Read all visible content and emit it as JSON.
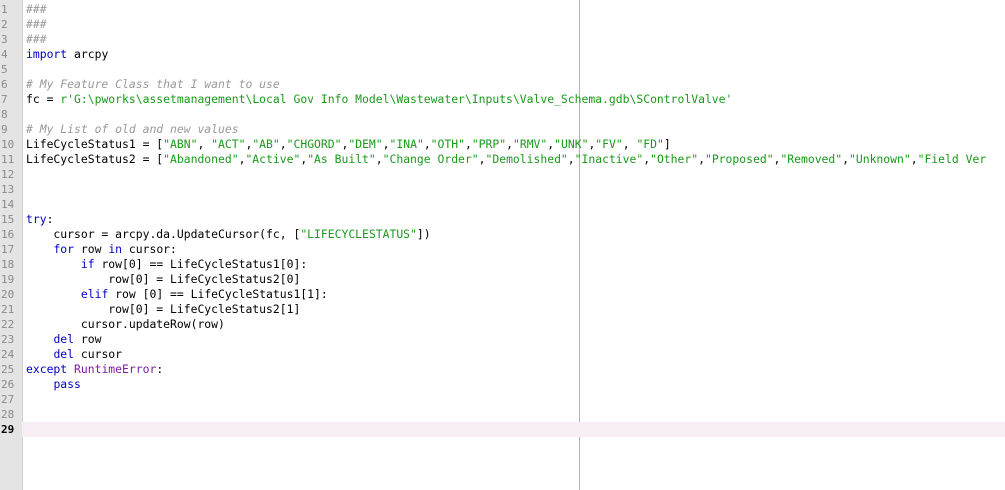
{
  "editor": {
    "colors": {
      "keyword": "#0000c8",
      "exception": "#7a1fa2",
      "string": "#1a9a1a",
      "comment": "#9a9a9a",
      "gutter": "#e4e4e4",
      "current_line": "#f8eef5"
    },
    "current_line": 29,
    "lines": [
      {
        "num": "1",
        "tokens": [
          {
            "t": "###",
            "c": "cm"
          }
        ]
      },
      {
        "num": "2",
        "tokens": [
          {
            "t": "###",
            "c": "cm"
          }
        ]
      },
      {
        "num": "3",
        "tokens": [
          {
            "t": "###",
            "c": "cm"
          }
        ]
      },
      {
        "num": "4",
        "tokens": [
          {
            "t": "import",
            "c": "kw"
          },
          {
            "t": " arcpy"
          }
        ]
      },
      {
        "num": "5",
        "tokens": []
      },
      {
        "num": "6",
        "tokens": [
          {
            "t": "# My Feature Class that I want to use",
            "c": "cm"
          }
        ]
      },
      {
        "num": "7",
        "tokens": [
          {
            "t": "fc = "
          },
          {
            "t": "r'G:\\pworks\\assetmanagement\\Local Gov Info Model\\Wastewater\\Inputs\\Valve_Schema.gdb\\SControlValve'",
            "c": "str"
          }
        ]
      },
      {
        "num": "8",
        "tokens": []
      },
      {
        "num": "9",
        "tokens": [
          {
            "t": "# My List of old and new values",
            "c": "cm"
          }
        ]
      },
      {
        "num": "10",
        "tokens": [
          {
            "t": "LifeCycleStatus1 = ["
          },
          {
            "t": "\"ABN\"",
            "c": "str"
          },
          {
            "t": ", "
          },
          {
            "t": "\"ACT\"",
            "c": "str"
          },
          {
            "t": ","
          },
          {
            "t": "\"AB\"",
            "c": "str"
          },
          {
            "t": ","
          },
          {
            "t": "\"CHGORD\"",
            "c": "str"
          },
          {
            "t": ","
          },
          {
            "t": "\"DEM\"",
            "c": "str"
          },
          {
            "t": ","
          },
          {
            "t": "\"INA\"",
            "c": "str"
          },
          {
            "t": ","
          },
          {
            "t": "\"OTH\"",
            "c": "str"
          },
          {
            "t": ","
          },
          {
            "t": "\"PRP\"",
            "c": "str"
          },
          {
            "t": ","
          },
          {
            "t": "\"RMV\"",
            "c": "str"
          },
          {
            "t": ","
          },
          {
            "t": "\"UNK\"",
            "c": "str"
          },
          {
            "t": ","
          },
          {
            "t": "\"FV\"",
            "c": "str"
          },
          {
            "t": ", "
          },
          {
            "t": "\"FD\"",
            "c": "str"
          },
          {
            "t": "]"
          }
        ]
      },
      {
        "num": "11",
        "tokens": [
          {
            "t": "LifeCycleStatus2 = ["
          },
          {
            "t": "\"Abandoned\"",
            "c": "str"
          },
          {
            "t": ","
          },
          {
            "t": "\"Active\"",
            "c": "str"
          },
          {
            "t": ","
          },
          {
            "t": "\"As Built\"",
            "c": "str"
          },
          {
            "t": ","
          },
          {
            "t": "\"Change Order\"",
            "c": "str"
          },
          {
            "t": ","
          },
          {
            "t": "\"Demolished\"",
            "c": "str"
          },
          {
            "t": ","
          },
          {
            "t": "\"Inactive\"",
            "c": "str"
          },
          {
            "t": ","
          },
          {
            "t": "\"Other\"",
            "c": "str"
          },
          {
            "t": ","
          },
          {
            "t": "\"Proposed\"",
            "c": "str"
          },
          {
            "t": ","
          },
          {
            "t": "\"Removed\"",
            "c": "str"
          },
          {
            "t": ","
          },
          {
            "t": "\"Unknown\"",
            "c": "str"
          },
          {
            "t": ","
          },
          {
            "t": "\"Field Ver",
            "c": "str"
          }
        ]
      },
      {
        "num": "12",
        "tokens": []
      },
      {
        "num": "13",
        "tokens": []
      },
      {
        "num": "14",
        "tokens": []
      },
      {
        "num": "15",
        "tokens": [
          {
            "t": "try",
            "c": "kw"
          },
          {
            "t": ":"
          }
        ]
      },
      {
        "num": "16",
        "tokens": [
          {
            "t": "    cursor = arcpy.da.UpdateCursor(fc, ["
          },
          {
            "t": "\"LIFECYCLESTATUS\"",
            "c": "str"
          },
          {
            "t": "])"
          }
        ]
      },
      {
        "num": "17",
        "tokens": [
          {
            "t": "    "
          },
          {
            "t": "for",
            "c": "kw"
          },
          {
            "t": " row "
          },
          {
            "t": "in",
            "c": "kw"
          },
          {
            "t": " cursor:"
          }
        ]
      },
      {
        "num": "18",
        "tokens": [
          {
            "t": "        "
          },
          {
            "t": "if",
            "c": "kw"
          },
          {
            "t": " row[0] == LifeCycleStatus1[0]:"
          }
        ]
      },
      {
        "num": "19",
        "tokens": [
          {
            "t": "            row[0] = LifeCycleStatus2[0]"
          }
        ]
      },
      {
        "num": "20",
        "tokens": [
          {
            "t": "        "
          },
          {
            "t": "elif",
            "c": "kw"
          },
          {
            "t": " row [0] == LifeCycleStatus1[1]:"
          }
        ]
      },
      {
        "num": "21",
        "tokens": [
          {
            "t": "            row[0] = LifeCycleStatus2[1]"
          }
        ]
      },
      {
        "num": "22",
        "tokens": [
          {
            "t": "        cursor.updateRow(row)"
          }
        ]
      },
      {
        "num": "23",
        "tokens": [
          {
            "t": "    "
          },
          {
            "t": "del",
            "c": "kw"
          },
          {
            "t": " row"
          }
        ]
      },
      {
        "num": "24",
        "tokens": [
          {
            "t": "    "
          },
          {
            "t": "del",
            "c": "kw"
          },
          {
            "t": " cursor"
          }
        ]
      },
      {
        "num": "25",
        "tokens": [
          {
            "t": "except",
            "c": "kw"
          },
          {
            "t": " "
          },
          {
            "t": "RuntimeError",
            "c": "kw2"
          },
          {
            "t": ":"
          }
        ]
      },
      {
        "num": "26",
        "tokens": [
          {
            "t": "    "
          },
          {
            "t": "pass",
            "c": "kw"
          }
        ]
      },
      {
        "num": "27",
        "tokens": []
      },
      {
        "num": "28",
        "tokens": []
      },
      {
        "num": "29",
        "tokens": []
      }
    ]
  }
}
